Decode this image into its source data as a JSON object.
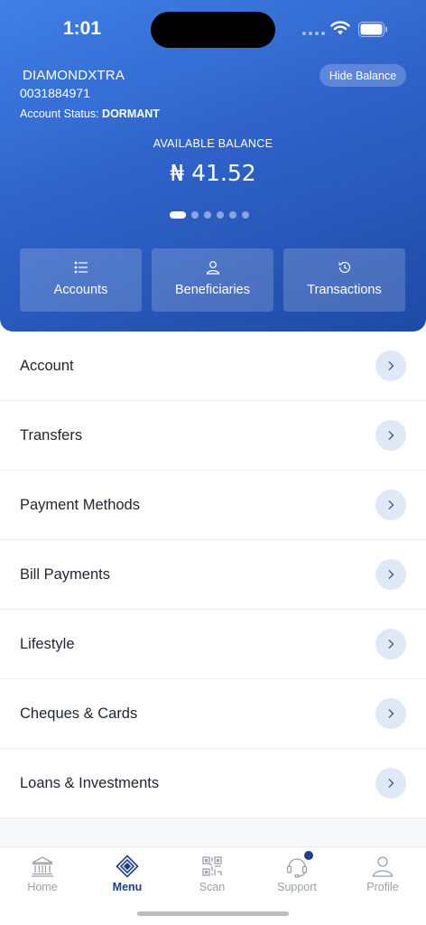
{
  "status_bar": {
    "time": "1:01"
  },
  "account": {
    "name": "DIAMONDXTRA",
    "number": "0031884971",
    "status_label": "Account Status:",
    "status_value": "DORMANT",
    "hide_balance_label": "Hide Balance",
    "balance_label": "AVAILABLE BALANCE",
    "balance": "₦ 41.52",
    "pager": {
      "pages": 6,
      "current": 1
    }
  },
  "quick_actions": [
    {
      "label": "Accounts",
      "icon": "list-icon"
    },
    {
      "label": "Beneficiaries",
      "icon": "user-icon"
    },
    {
      "label": "Transactions",
      "icon": "history-icon"
    }
  ],
  "menu": [
    {
      "label": "Account"
    },
    {
      "label": "Transfers"
    },
    {
      "label": "Payment Methods"
    },
    {
      "label": "Bill Payments"
    },
    {
      "label": "Lifestyle"
    },
    {
      "label": "Cheques & Cards"
    },
    {
      "label": "Loans & Investments"
    }
  ],
  "tabbar": [
    {
      "label": "Home",
      "icon": "bank-icon"
    },
    {
      "label": "Menu",
      "icon": "menu-diamond-icon",
      "active": true
    },
    {
      "label": "Scan",
      "icon": "qr-icon"
    },
    {
      "label": "Support",
      "icon": "headset-icon"
    },
    {
      "label": "Profile",
      "icon": "profile-icon"
    }
  ],
  "colors": {
    "accent": "#1e3f8f",
    "header_start": "#3f80e6",
    "header_end": "#1e4aa6"
  }
}
